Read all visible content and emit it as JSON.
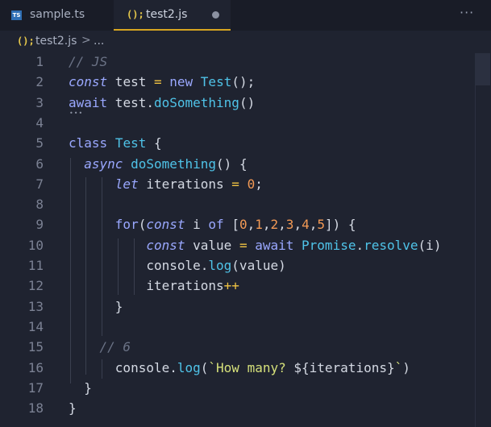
{
  "tabs": [
    {
      "icon": "TS",
      "label": "sample.ts",
      "active": false
    },
    {
      "icon": "(); ",
      "label": "test2.js",
      "active": true,
      "modified": true
    }
  ],
  "more_actions": "···",
  "breadcrumb": {
    "file": "test2.js",
    "separator": ">",
    "rest": "..."
  },
  "line_numbers": [
    "1",
    "2",
    "3",
    "4",
    "5",
    "6",
    "7",
    "8",
    "9",
    "10",
    "11",
    "12",
    "13",
    "14",
    "15",
    "16",
    "17",
    "18"
  ],
  "code": [
    [
      [
        "c",
        "// JS"
      ]
    ],
    [
      [
        "k",
        "const"
      ],
      [
        "t",
        " test "
      ],
      [
        "op",
        "="
      ],
      [
        "t",
        " "
      ],
      [
        "kw",
        "new"
      ],
      [
        "t",
        " "
      ],
      [
        "n",
        "Test"
      ],
      [
        "t",
        "();"
      ]
    ],
    [
      [
        "kw",
        "await"
      ],
      [
        "t",
        " test."
      ],
      [
        "n",
        "doSomething"
      ],
      [
        "t",
        "()"
      ]
    ],
    [],
    [
      [
        "kw",
        "class"
      ],
      [
        "t",
        " "
      ],
      [
        "n",
        "Test"
      ],
      [
        "t",
        " {"
      ]
    ],
    [
      [
        "t",
        "  "
      ],
      [
        "k",
        "async"
      ],
      [
        "t",
        " "
      ],
      [
        "n",
        "doSomething"
      ],
      [
        "t",
        "() {"
      ]
    ],
    [
      [
        "t",
        "      "
      ],
      [
        "k",
        "let"
      ],
      [
        "t",
        " iterations "
      ],
      [
        "op",
        "="
      ],
      [
        "t",
        " "
      ],
      [
        "num",
        "0"
      ],
      [
        "t",
        ";"
      ]
    ],
    [],
    [
      [
        "t",
        "      "
      ],
      [
        "kw",
        "for"
      ],
      [
        "t",
        "("
      ],
      [
        "k",
        "const"
      ],
      [
        "t",
        " i "
      ],
      [
        "kw",
        "of"
      ],
      [
        "t",
        " ["
      ],
      [
        "num",
        "0"
      ],
      [
        "t",
        ","
      ],
      [
        "num",
        "1"
      ],
      [
        "t",
        ","
      ],
      [
        "num",
        "2"
      ],
      [
        "t",
        ","
      ],
      [
        "num",
        "3"
      ],
      [
        "t",
        ","
      ],
      [
        "num",
        "4"
      ],
      [
        "t",
        ","
      ],
      [
        "num",
        "5"
      ],
      [
        "t",
        "]) {"
      ]
    ],
    [
      [
        "t",
        "          "
      ],
      [
        "k",
        "const"
      ],
      [
        "t",
        " value "
      ],
      [
        "op",
        "="
      ],
      [
        "t",
        " "
      ],
      [
        "kw",
        "await"
      ],
      [
        "t",
        " "
      ],
      [
        "n",
        "Promise"
      ],
      [
        "t",
        "."
      ],
      [
        "n",
        "resolve"
      ],
      [
        "t",
        "(i)"
      ]
    ],
    [
      [
        "t",
        "          console."
      ],
      [
        "n",
        "log"
      ],
      [
        "t",
        "(value)"
      ]
    ],
    [
      [
        "t",
        "          iterations"
      ],
      [
        "op",
        "++"
      ]
    ],
    [
      [
        "t",
        "      }"
      ]
    ],
    [],
    [
      [
        "t",
        "    "
      ],
      [
        "c",
        "// 6"
      ]
    ],
    [
      [
        "t",
        "      console."
      ],
      [
        "n",
        "log"
      ],
      [
        "t",
        "("
      ],
      [
        "s",
        "`How many? "
      ],
      [
        "t",
        "${iterations}"
      ],
      [
        "s",
        "`"
      ],
      [
        "t",
        ")"
      ]
    ],
    [
      [
        "t",
        "  }"
      ]
    ],
    [
      [
        "t",
        "}"
      ]
    ]
  ]
}
